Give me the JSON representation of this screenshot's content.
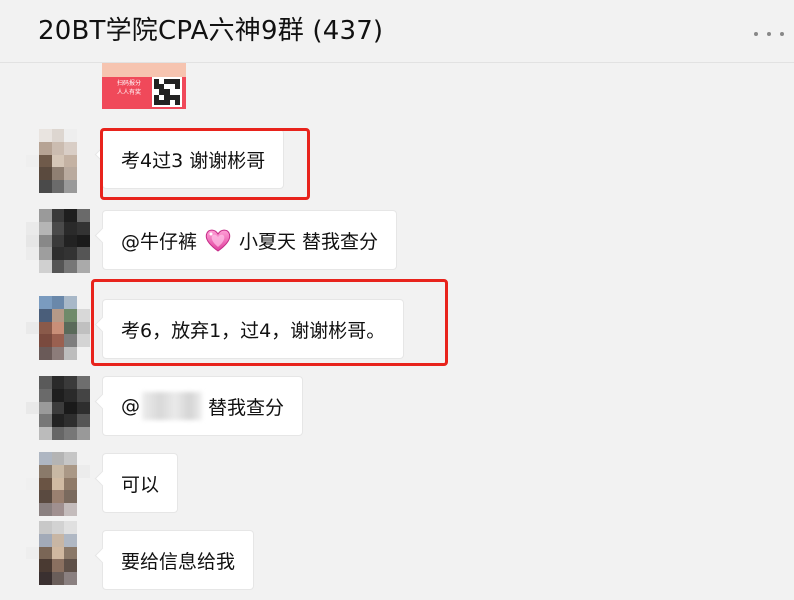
{
  "header": {
    "title": "20BT学院CPA六神9群 (437)",
    "more_icon": "more-horizontal-icon"
  },
  "previous_image": {
    "caption": "扫码报分\n人人有奖"
  },
  "messages": [
    {
      "text": "考4过3 谢谢彬哥",
      "highlighted": true
    },
    {
      "mention": "@牛仔裤",
      "emoji": "heart-emoji",
      "text_after": "小夏天 替我查分",
      "highlighted": false
    },
    {
      "text": "考6，放弃1，过4，谢谢彬哥。",
      "highlighted": true
    },
    {
      "mention_prefix": "@",
      "text_after": "替我查分",
      "highlighted": false,
      "blurred_mention": true
    },
    {
      "text": "可以",
      "highlighted": false
    },
    {
      "text": "要给信息给我",
      "highlighted": false
    }
  ],
  "colors": {
    "background": "#f2f2f2",
    "bubble": "#ffffff",
    "highlight_border": "#e8231c"
  }
}
